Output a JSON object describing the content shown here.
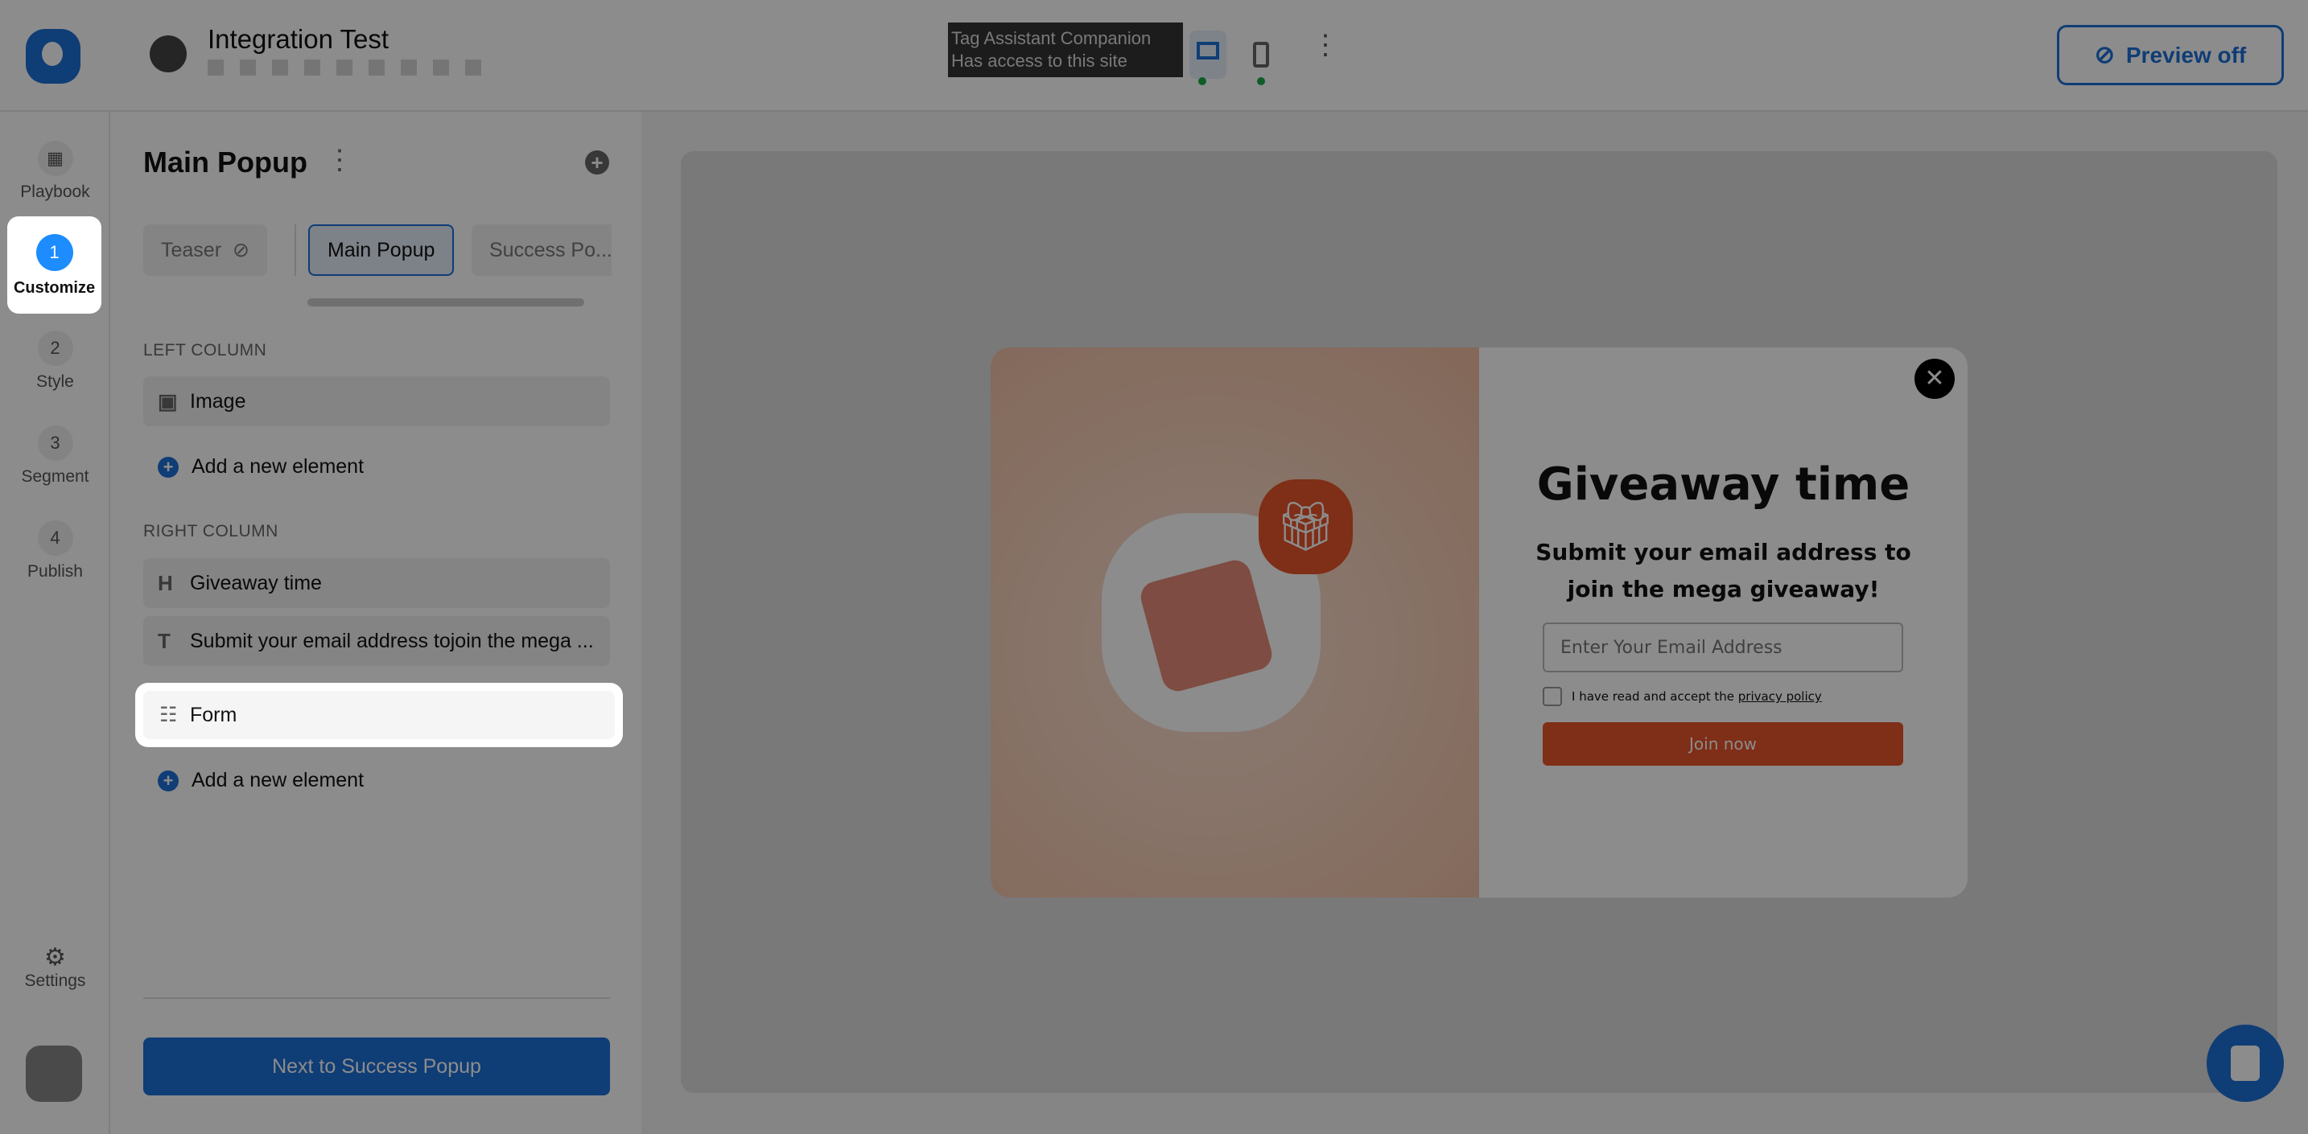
{
  "topbar": {
    "title": "Integration Test",
    "tooltip_line1": "Tag Assistant Companion",
    "tooltip_line2": "Has access to this site",
    "preview_label": "Preview off",
    "icons": [
      "globe-icon",
      "laptop-icon",
      "mobile-icon",
      "more-vertical-icon",
      "eye-off-icon"
    ]
  },
  "rail": {
    "items": [
      {
        "label": "Playbook",
        "icon": "grid-icon"
      },
      {
        "label": "Customize",
        "step": "1"
      },
      {
        "label": "Style",
        "step": "2"
      },
      {
        "label": "Segment",
        "step": "3"
      },
      {
        "label": "Publish",
        "step": "4"
      }
    ],
    "settings": "Settings"
  },
  "panel": {
    "title": "Main Popup",
    "tabs": [
      {
        "label": "Teaser"
      },
      {
        "label": "Main Popup"
      },
      {
        "label": "Success Po..."
      }
    ],
    "left_column": "LEFT COLUMN",
    "right_column": "RIGHT COLUMN",
    "left_items": [
      {
        "label": "Image",
        "icon": "image-icon"
      }
    ],
    "right_items": [
      {
        "label": "Giveaway time",
        "icon": "H"
      },
      {
        "label": "Submit your email address tojoin the mega ...",
        "icon": "T"
      },
      {
        "label": "Form",
        "icon": "form-icon"
      }
    ],
    "add_label": "Add a new element",
    "next_button": "Next to Success Popup"
  },
  "popup": {
    "heading": "Giveaway time",
    "subheading_line1": "Submit your email address to",
    "subheading_line2": "join the mega giveaway!",
    "email_placeholder": "Enter Your Email Address",
    "consent_text": "I have read and accept the ",
    "consent_link": "privacy policy",
    "join_button": "Join now",
    "accent": "#e8542a"
  },
  "colors": {
    "brand": "#1d6fd8"
  }
}
